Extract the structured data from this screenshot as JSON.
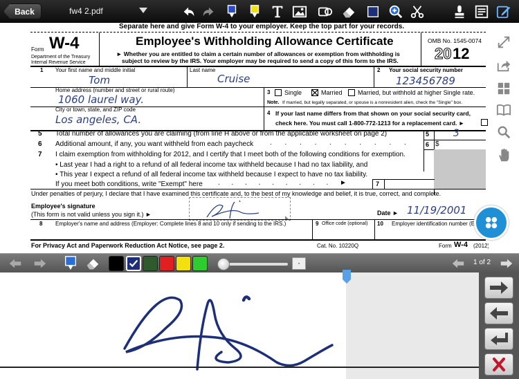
{
  "toolbar": {
    "back_label": "Back",
    "document_name": "fw4 2.pdf",
    "icons": [
      "undo-icon",
      "redo-icon",
      "pen-icon",
      "highlighter-icon",
      "text-icon",
      "image-icon",
      "shapes-icon",
      "eraser-icon",
      "square-icon",
      "zoom-icon",
      "scissors-icon",
      "stamp-icon",
      "notes-icon",
      "edit-icon"
    ]
  },
  "form": {
    "top_note": "Separate here and give Form W-4 to your employer. Keep the top part for your records.",
    "form_word": "Form",
    "form_number": "W-4",
    "dept_line1": "Department of the Treasury",
    "dept_line2": "Internal Revenue Service",
    "title": "Employee's Withholding Allowance Certificate",
    "subtitle1": "► Whether you are entitled to claim a certain number of allowances or exemption from withholding is",
    "subtitle2": "subject to review by the IRS. Your employer may be required to send a copy of this form to the IRS.",
    "omb": "OMB No. 1545-0074",
    "year_prefix": "20",
    "year_suffix": "12",
    "line1_num": "1",
    "line1_label": "Your first name and middle initial",
    "lastname_label": "Last name",
    "line2_num": "2",
    "ssn_label": "Your social security number",
    "first_name": "Tom",
    "last_name": "Cruise",
    "ssn": "123456789",
    "address_label": "Home address (number and street or rural route)",
    "address": "1060 laurel way.",
    "line3_num": "3",
    "single": "Single",
    "married": "Married",
    "married_higher": "Married, but withhold at higher Single rate.",
    "note_bold": "Note.",
    "note": "If married, but legally separated, or spouse is a nonresident alien, check the \"Single\" box.",
    "city_label": "City or town, state, and ZIP code",
    "city": "Los angeles, CA.",
    "line4_num": "4",
    "line4_a": "If your last name differs from that shown on your social security card,",
    "line4_b": "check here. You must call 1-800-772-1213 for a replacement card. ►",
    "line5_num": "5",
    "line5_text": "Total number of allowances you are claiming (from line H above or from the applicable worksheet on page 2)",
    "line5_value": "3",
    "line6_num": "6",
    "line6_text": "Additional amount, if any, you want withheld from each paycheck",
    "line6_dollar": "$",
    "line7_num": "7",
    "line7_text": "I claim exemption from withholding for 2012, and I certify that I meet both of the following conditions for exemption.",
    "bullet1": "• Last year I had a right to a refund of all federal income tax withheld because I had no tax liability, and",
    "bullet2": "• This year I expect a refund of all federal income tax withheld because I expect to have no tax liability.",
    "exempt_text": "If you meet both conditions, write \"Exempt\" here",
    "perjury": "Under penalties of perjury, I declare that I have examined this certificate and, to the best of my knowledge and belief, it is true, correct, and complete.",
    "sig_label": "Employee's signature",
    "sig_sub": "(This form is not valid unless you sign it.) ►",
    "date_label": "Date ►",
    "date_value": "11/19/2001",
    "line8_num": "8",
    "line8_text": "Employer's name and address (Employer: Complete lines 8 and 10 only if sending to the IRS.)",
    "line9_num": "9",
    "line9_text": "Office code (optional)",
    "line10_num": "10",
    "line10_text": "Employer identification number (EIN)",
    "footer_left": "For Privacy Act and Paperwork Reduction Act Notice, see page 2.",
    "footer_cat": "Cat. No. 10220Q",
    "footer_form": "Form",
    "footer_w4": "W-4",
    "footer_year": "(2012)"
  },
  "sigbar": {
    "colors": [
      "#000000",
      "#1e2f7a",
      "#2e5a2e",
      "#e02020",
      "#f2e010",
      "#2ecc2e"
    ],
    "selected_color": "#1e2f7a",
    "dot_label": "·",
    "page_indicator": "1 of 2"
  },
  "sidebar": {
    "icons": [
      "resize-icon",
      "share-icon",
      "grid-icon",
      "book-icon",
      "search-icon",
      "hand-icon"
    ]
  },
  "side_panel": {
    "buttons": [
      "next-arrow-icon",
      "previous-arrow-icon",
      "return-icon",
      "delete-icon"
    ]
  }
}
